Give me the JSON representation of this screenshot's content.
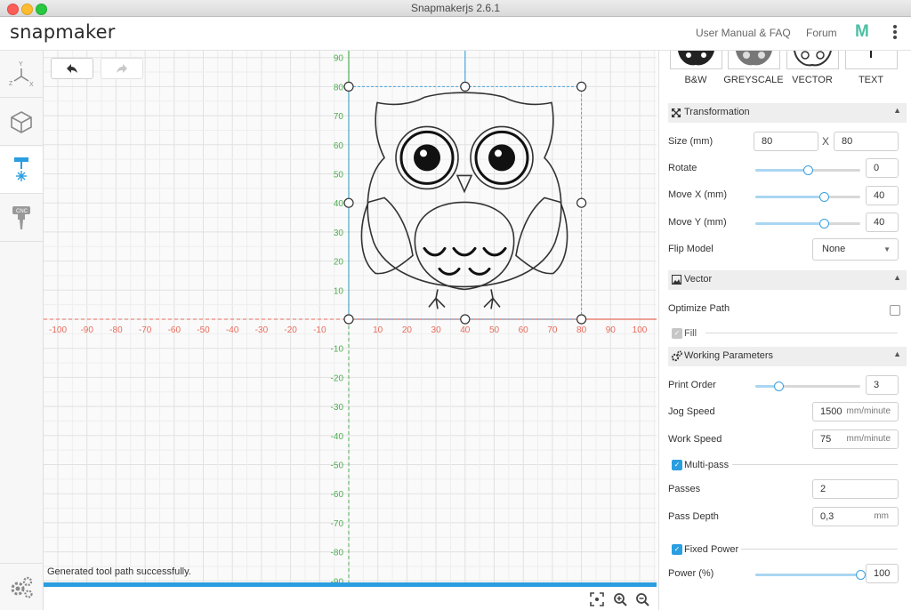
{
  "window": {
    "title": "Snapmakerjs 2.6.1"
  },
  "header": {
    "logo": "snapmaker",
    "links": [
      "User Manual & FAQ",
      "Forum"
    ],
    "brand_logo": "M",
    "menu_icon": "more-vertical-icon"
  },
  "sidebar": {
    "items": [
      "axes-view-icon",
      "3d-cube-icon",
      "laser-icon",
      "cnc-icon"
    ],
    "bottom": "settings-gear-icon"
  },
  "canvas": {
    "x_ticks": [
      "-100",
      "-90",
      "-80",
      "-70",
      "-60",
      "-50",
      "-40",
      "-30",
      "-20",
      "-10",
      "10",
      "20",
      "30",
      "40",
      "50",
      "60",
      "70",
      "80",
      "90",
      "100"
    ],
    "y_ticks": [
      "90",
      "80",
      "70",
      "60",
      "50",
      "40",
      "30",
      "20",
      "10",
      "-10",
      "-20",
      "-30",
      "-40",
      "-50",
      "-60",
      "-70",
      "-80",
      "-90"
    ],
    "selection_labels": {
      "top": "80",
      "left": "40",
      "bottom_mid": "40",
      "bottom_right": "80",
      "right": "40"
    },
    "status": "Generated tool path successfully.",
    "colors": {
      "x_axis": "#e86b5a",
      "y_axis": "#4caf50",
      "selection": "#4aa7dc",
      "progress": "#2a9ee0"
    }
  },
  "panel": {
    "modes": [
      "B&W",
      "GREYSCALE",
      "VECTOR",
      "TEXT"
    ],
    "transformation": {
      "title": "Transformation",
      "size_label": "Size (mm)",
      "size_x": "80",
      "size_sep": "X",
      "size_y": "80",
      "rotate_label": "Rotate",
      "rotate_value": "0",
      "rotate_slider": 0.5,
      "movex_label": "Move X (mm)",
      "movex_value": "40",
      "movex_slider": 0.65,
      "movey_label": "Move Y (mm)",
      "movey_value": "40",
      "movey_slider": 0.65,
      "flip_label": "Flip Model",
      "flip_value": "None"
    },
    "vector": {
      "title": "Vector",
      "optimize_label": "Optimize Path",
      "fill_label": "Fill"
    },
    "working": {
      "title": "Working Parameters",
      "print_order_label": "Print Order",
      "print_order_value": "3",
      "print_order_slider": 0.22,
      "jog_label": "Jog Speed",
      "jog_value": "1500",
      "jog_unit": "mm/minute",
      "work_label": "Work Speed",
      "work_value": "75",
      "work_unit": "mm/minute",
      "multipass_label": "Multi-pass",
      "passes_label": "Passes",
      "passes_value": "2",
      "depth_label": "Pass Depth",
      "depth_value": "0,3",
      "depth_unit": "mm",
      "fixed_power_label": "Fixed Power",
      "power_label": "Power (%)",
      "power_value": "100",
      "power_slider": 1.0
    }
  }
}
